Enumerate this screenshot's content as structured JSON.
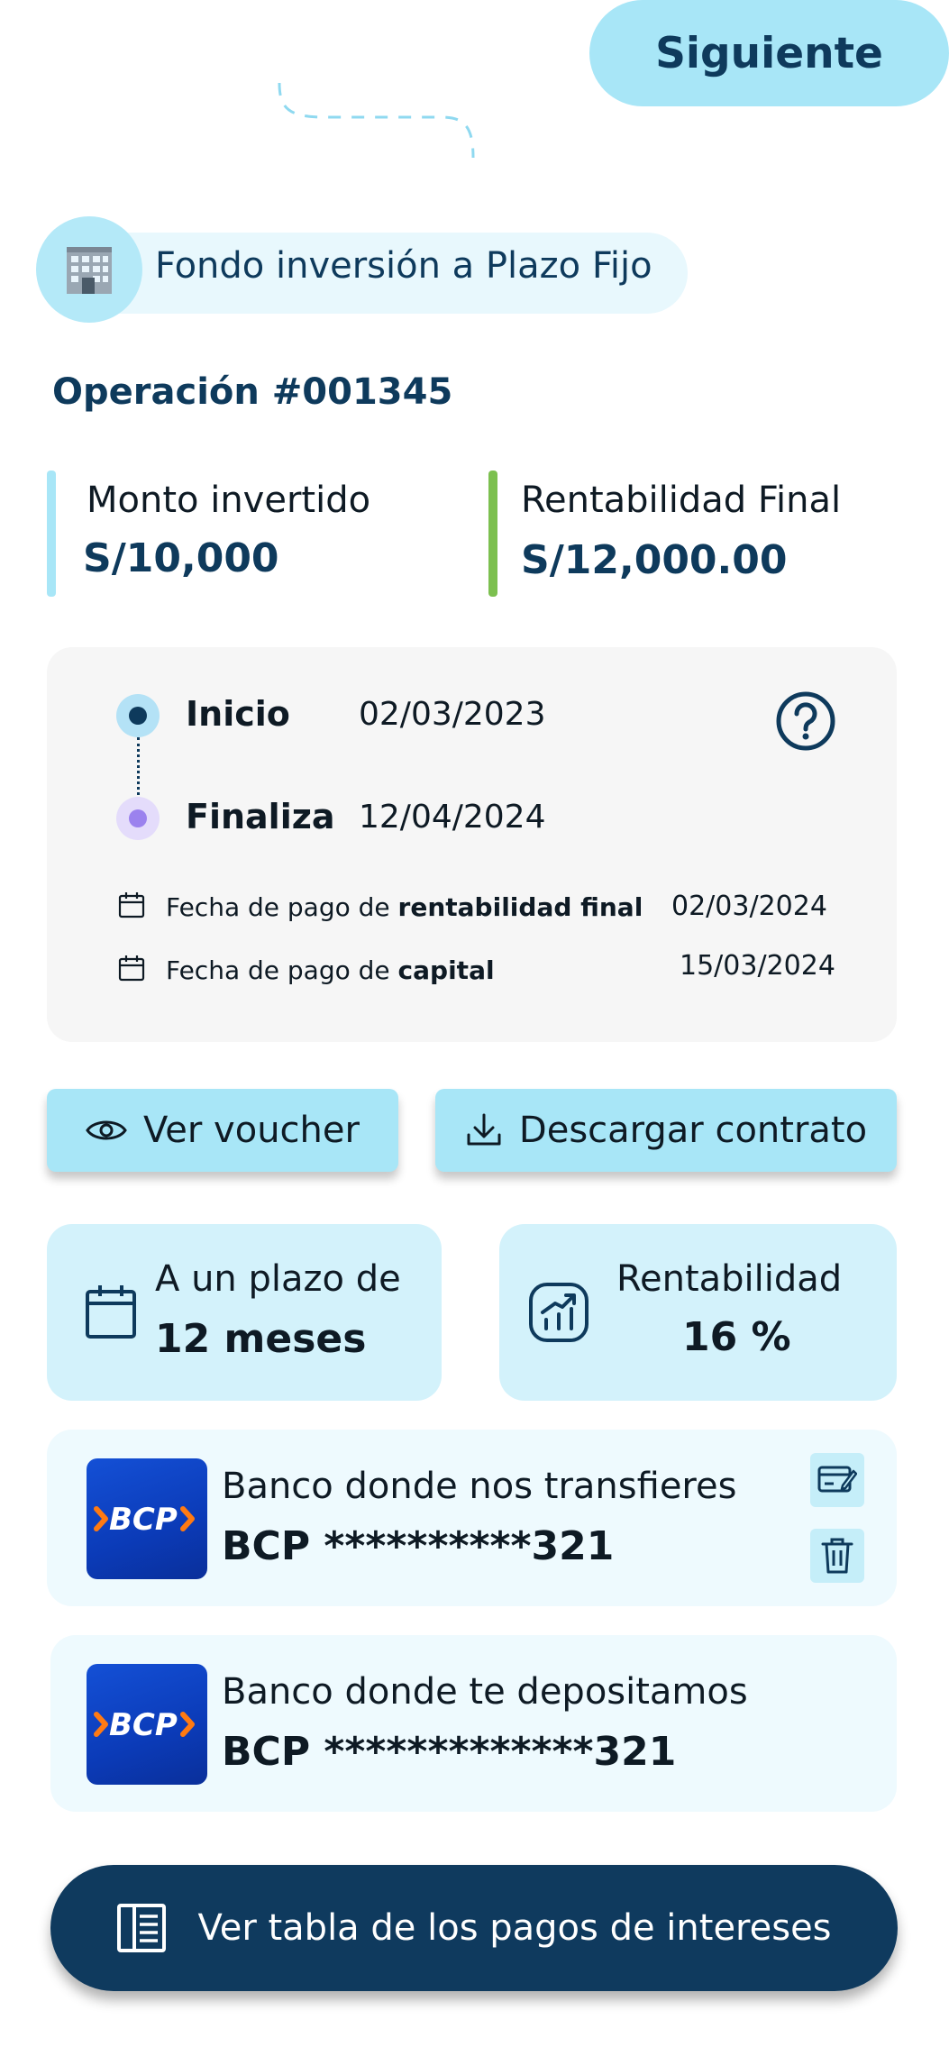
{
  "header": {
    "next_label": "Siguiente"
  },
  "fund": {
    "icon": "office-building-icon",
    "title": "Fondo inversión a Plazo Fijo"
  },
  "operation": {
    "title": "Operación #001345"
  },
  "summary": {
    "amount_label": "Monto invertido",
    "amount_value": "S/10,000",
    "return_label": "Rentabilidad Final",
    "return_value": "S/12,000.00",
    "accent_amount": "#a8e6f7",
    "accent_return": "#7cc04f"
  },
  "dates": {
    "start_label": "Inicio",
    "start_date": "02/03/2023",
    "end_label": "Finaliza",
    "end_date": "12/04/2024",
    "payment_final_prefix": "Fecha de pago de ",
    "payment_final_bold": "rentabilidad final",
    "payment_final_date": "02/03/2024",
    "payment_capital_prefix": "Fecha de pago de ",
    "payment_capital_bold": "capital",
    "payment_capital_date": "15/03/2024"
  },
  "actions": {
    "voucher_label": "Ver voucher",
    "contract_label": "Descargar contrato"
  },
  "term": {
    "line1": "A un plazo de",
    "line2": "12 meses"
  },
  "profitability": {
    "line1": "Rentabilidad",
    "line2": "16 %"
  },
  "banks": [
    {
      "logo_text": "BCP",
      "label": "Banco donde nos transfieres",
      "account": "BCP **********321"
    },
    {
      "logo_text": "BCP",
      "label": "Banco donde te depositamos",
      "account": "BCP *************321"
    }
  ],
  "bottom": {
    "table_label": "Ver tabla de los pagos de intereses"
  },
  "colors": {
    "primary": "#0f3a5e",
    "light": "#a8e6f7",
    "card": "#d3f2fb"
  }
}
